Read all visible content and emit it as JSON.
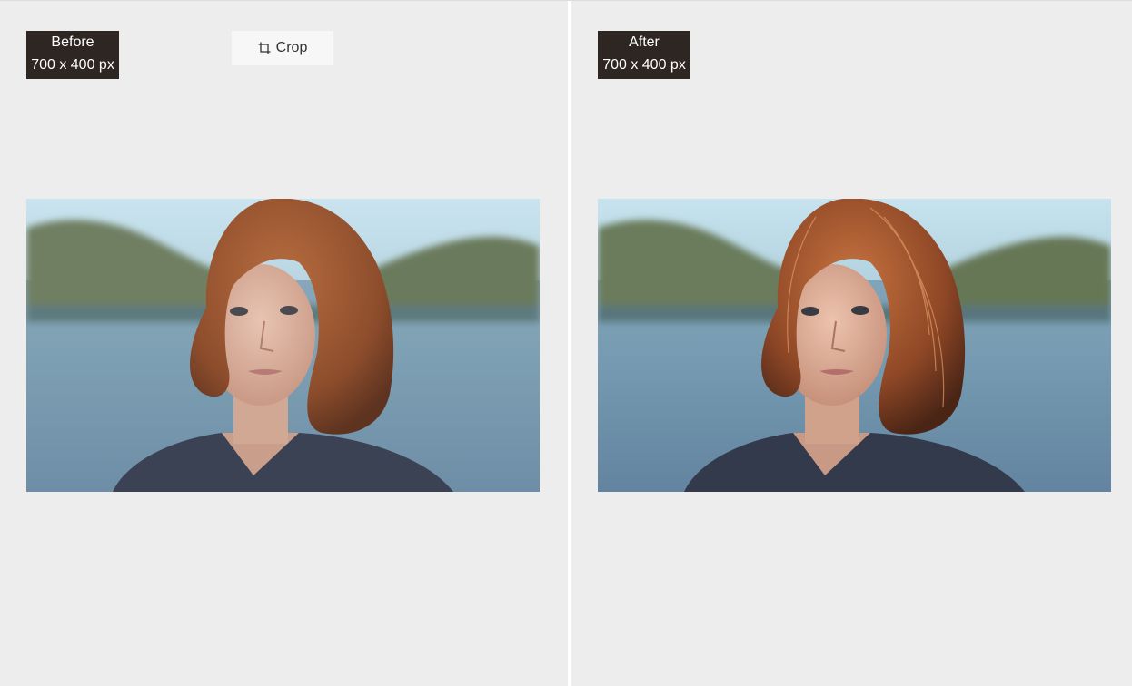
{
  "before": {
    "title": "Before",
    "size": "700 x 400 px"
  },
  "after": {
    "title": "After",
    "size": "700 x 400 px"
  },
  "toolbar": {
    "crop_label": "Crop",
    "crop_icon": "crop-icon"
  },
  "colors": {
    "background": "#ededed",
    "badge": "#2d2622",
    "badge_text": "#ffffff",
    "button_bg": "#f7f7f7",
    "divider": "#ffffff"
  }
}
